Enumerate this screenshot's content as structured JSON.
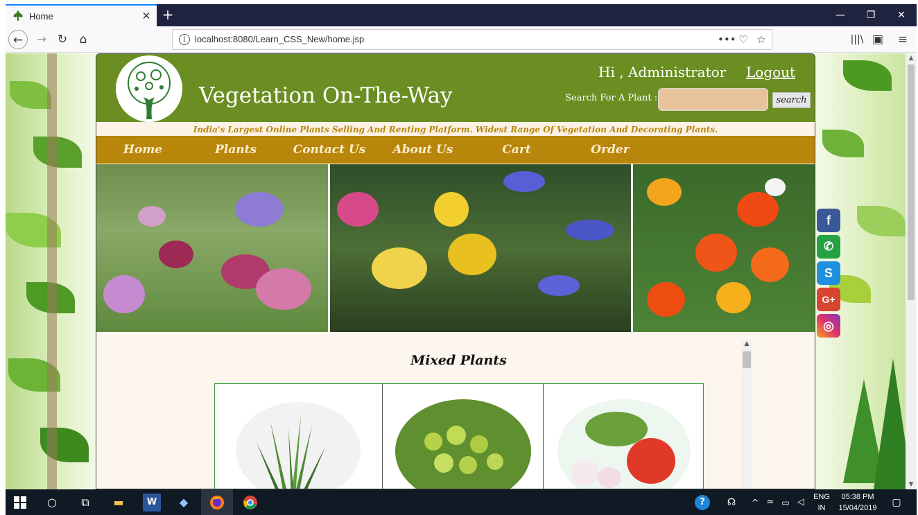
{
  "browser": {
    "tab_title": "Home",
    "tab_close": "✕",
    "new_tab": "+",
    "url": "localhost:8080/Learn_CSS_New/home.jsp",
    "url_actions": [
      "•••",
      "♡",
      "☆"
    ],
    "window_controls": {
      "minimize": "—",
      "restore": "❐",
      "close": "✕"
    }
  },
  "header": {
    "site_title": "Vegetation On-The-Way",
    "greeting": "Hi , Administrator",
    "logout": "Logout",
    "search_label": "Search For A Plant :",
    "search_placeholder": "",
    "search_button": "search"
  },
  "tagline": "India's Largest Online Plants Selling And Renting Platform. Widest Range Of Vegetation And Decorating Plants.",
  "menu": [
    "Home",
    "Plants",
    "Contact Us",
    "About Us",
    "Cart",
    "Order"
  ],
  "section": {
    "title": "Mixed Plants"
  },
  "social": {
    "facebook": "f",
    "whatsapp": "✆",
    "skype": "S",
    "googleplus": "G+",
    "instagram": "◎"
  },
  "taskbar": {
    "language_1": "ENG",
    "language_2": "IN",
    "time": "05:38 PM",
    "date": "15/04/2019"
  },
  "colors": {
    "header_green": "#6b8e23",
    "menu_gold": "#b8860b",
    "tagline_gold": "#b8860b",
    "search_fill": "#e8c29a",
    "browser_dark": "#202340",
    "taskbar": "#101a24"
  }
}
